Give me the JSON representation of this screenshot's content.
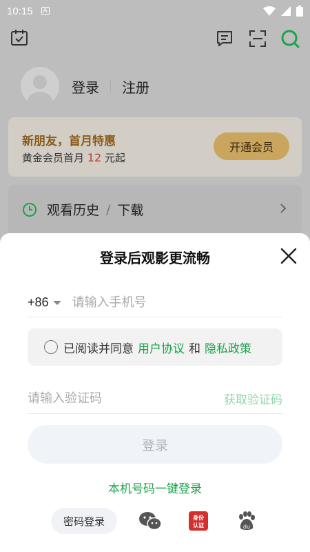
{
  "status_bar": {
    "time": "10:15",
    "notif_letter": "A"
  },
  "profile": {
    "login": "登录",
    "register": "注册"
  },
  "promo": {
    "title": "新朋友，首月特惠",
    "sub_prefix": "黄金会员首月",
    "price": "12",
    "sub_suffix": "元起",
    "button": "开通会员"
  },
  "history": {
    "label": "观看历史",
    "slash": "/",
    "download": "下载"
  },
  "sheet": {
    "title": "登录后观影更流畅",
    "country_code": "+86",
    "phone_placeholder": "请输入手机号",
    "agree_prefix": "已阅读并同意",
    "user_agreement": "用户协议",
    "and": "和",
    "privacy_policy": "隐私政策",
    "code_placeholder": "请输入验证码",
    "get_code": "获取验证码",
    "login_button": "登录",
    "one_key_login": "本机号码一键登录",
    "password_login": "密码登录",
    "id_badge_line1": "身份",
    "id_badge_line2": "认证"
  },
  "colors": {
    "accent_green": "#1aa34a",
    "vip_gold": "#c9a55e",
    "price_red": "#c0392b"
  },
  "icons": [
    "calendar-check-icon",
    "message-icon",
    "scan-icon",
    "search-icon",
    "clock-icon",
    "chevron-right-icon",
    "close-icon",
    "wechat-icon",
    "id-verify-icon",
    "baidu-icon"
  ]
}
